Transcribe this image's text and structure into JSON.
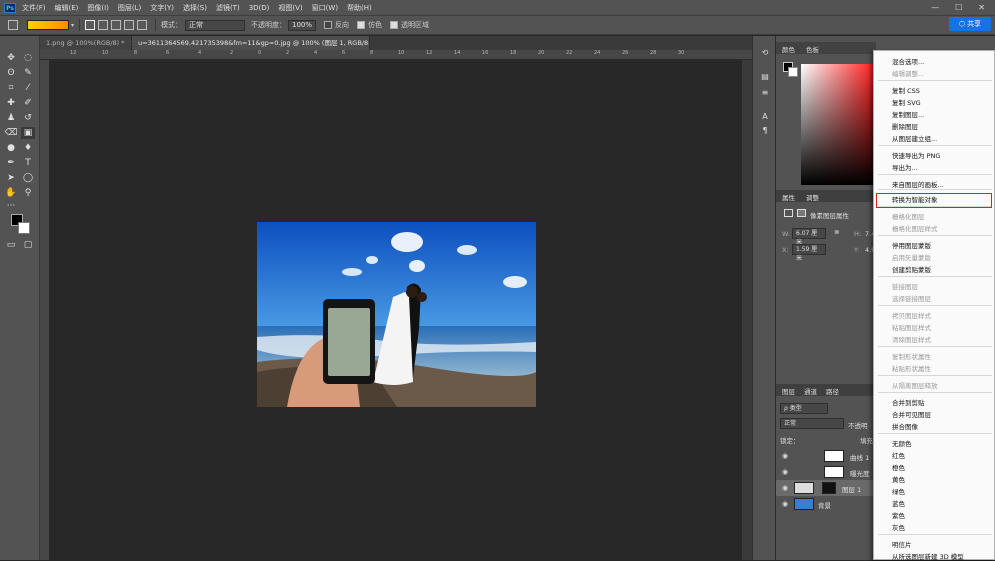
{
  "menubar": {
    "logo": "Ps",
    "items": [
      "文件(F)",
      "编辑(E)",
      "图像(I)",
      "图层(L)",
      "文字(Y)",
      "选择(S)",
      "滤镜(T)",
      "3D(D)",
      "视图(V)",
      "窗口(W)",
      "帮助(H)"
    ],
    "window_controls": [
      "—",
      "☐",
      "✕"
    ]
  },
  "options": {
    "mode_label": "模式：",
    "mode_value": "正常",
    "opacity_label": "不透明度：",
    "opacity_value": "100%",
    "reverse_label": "反向",
    "dither_label": "仿色",
    "transparency_label": "透明区域"
  },
  "share_button": "共享",
  "tabs": [
    {
      "label": "1.png @ 100%(RGB/8) *",
      "close": "×"
    },
    {
      "label": "u=3611364569,421735398&fm=11&gp=0.jpg @ 100% (图层 1, RGB/8#) *",
      "close": "×"
    }
  ],
  "ruler_ticks": [
    "12",
    "10",
    "8",
    "6",
    "4",
    "2",
    "0",
    "2",
    "4",
    "6",
    "8",
    "10",
    "12",
    "14",
    "16",
    "18",
    "20",
    "22",
    "24",
    "26",
    "28",
    "30"
  ],
  "panels": {
    "color_tabs": [
      "颜色",
      "色板"
    ],
    "properties_tabs": [
      "属性",
      "调整"
    ],
    "properties_title": "像素图层属性",
    "w_label": "W:",
    "w_value": "6.07 厘米",
    "h_label": "H:",
    "h_value": "7.4",
    "x_label": "X:",
    "x_value": "1.59 厘米",
    "y_label": "Y:",
    "y_value": "4.9",
    "layers_tabs": [
      "图层",
      "通道",
      "路径"
    ],
    "kind_label": "ρ 类型",
    "blend_label": "正常",
    "opacity_label": "不透明",
    "lock_label": "锁定：",
    "fill_label": "填充",
    "layers": [
      {
        "name": "曲线 1"
      },
      {
        "name": "曝光度"
      },
      {
        "name": "图层 1"
      },
      {
        "name": "背景"
      }
    ]
  },
  "context_menu": {
    "items": [
      {
        "label": "混合选项...",
        "disabled": false
      },
      {
        "label": "编辑调整...",
        "disabled": true
      },
      {
        "label": "复制 CSS",
        "disabled": false
      },
      {
        "label": "复制 SVG",
        "disabled": false
      },
      {
        "label": "复制图层...",
        "disabled": false
      },
      {
        "label": "删除图层",
        "disabled": false
      },
      {
        "label": "从图层建立组...",
        "disabled": false
      },
      {
        "label": "快速导出为 PNG",
        "disabled": false
      },
      {
        "label": "导出为...",
        "disabled": false
      },
      {
        "label": "来自图层的画板...",
        "disabled": false
      },
      {
        "label": "转换为智能对象",
        "disabled": false
      },
      {
        "label": "栅格化图层",
        "disabled": true
      },
      {
        "label": "栅格化图层样式",
        "disabled": true
      },
      {
        "label": "停用图层蒙版",
        "disabled": false
      },
      {
        "label": "启用矢量蒙版",
        "disabled": true
      },
      {
        "label": "创建剪贴蒙版",
        "disabled": false
      },
      {
        "label": "链接图层",
        "disabled": true
      },
      {
        "label": "选择链接图层",
        "disabled": true
      },
      {
        "label": "拷贝图层样式",
        "disabled": true
      },
      {
        "label": "粘贴图层样式",
        "disabled": true
      },
      {
        "label": "清除图层样式",
        "disabled": true
      },
      {
        "label": "复制形状属性",
        "disabled": true
      },
      {
        "label": "粘贴形状属性",
        "disabled": true
      },
      {
        "label": "从隔离图层释放",
        "disabled": true
      },
      {
        "label": "合并到剪贴",
        "disabled": false
      },
      {
        "label": "合并可见图层",
        "disabled": false
      },
      {
        "label": "拼合图像",
        "disabled": false
      },
      {
        "label": "无颜色",
        "disabled": false
      },
      {
        "label": "红色",
        "disabled": false
      },
      {
        "label": "橙色",
        "disabled": false
      },
      {
        "label": "黄色",
        "disabled": false
      },
      {
        "label": "绿色",
        "disabled": false
      },
      {
        "label": "蓝色",
        "disabled": false
      },
      {
        "label": "紫色",
        "disabled": false
      },
      {
        "label": "灰色",
        "disabled": false
      },
      {
        "label": "明信片",
        "disabled": false
      },
      {
        "label": "从所选图层新建 3D 模型",
        "disabled": false
      }
    ]
  },
  "colors": {
    "accent": "#1473e6",
    "highlight": "#e0201f"
  }
}
